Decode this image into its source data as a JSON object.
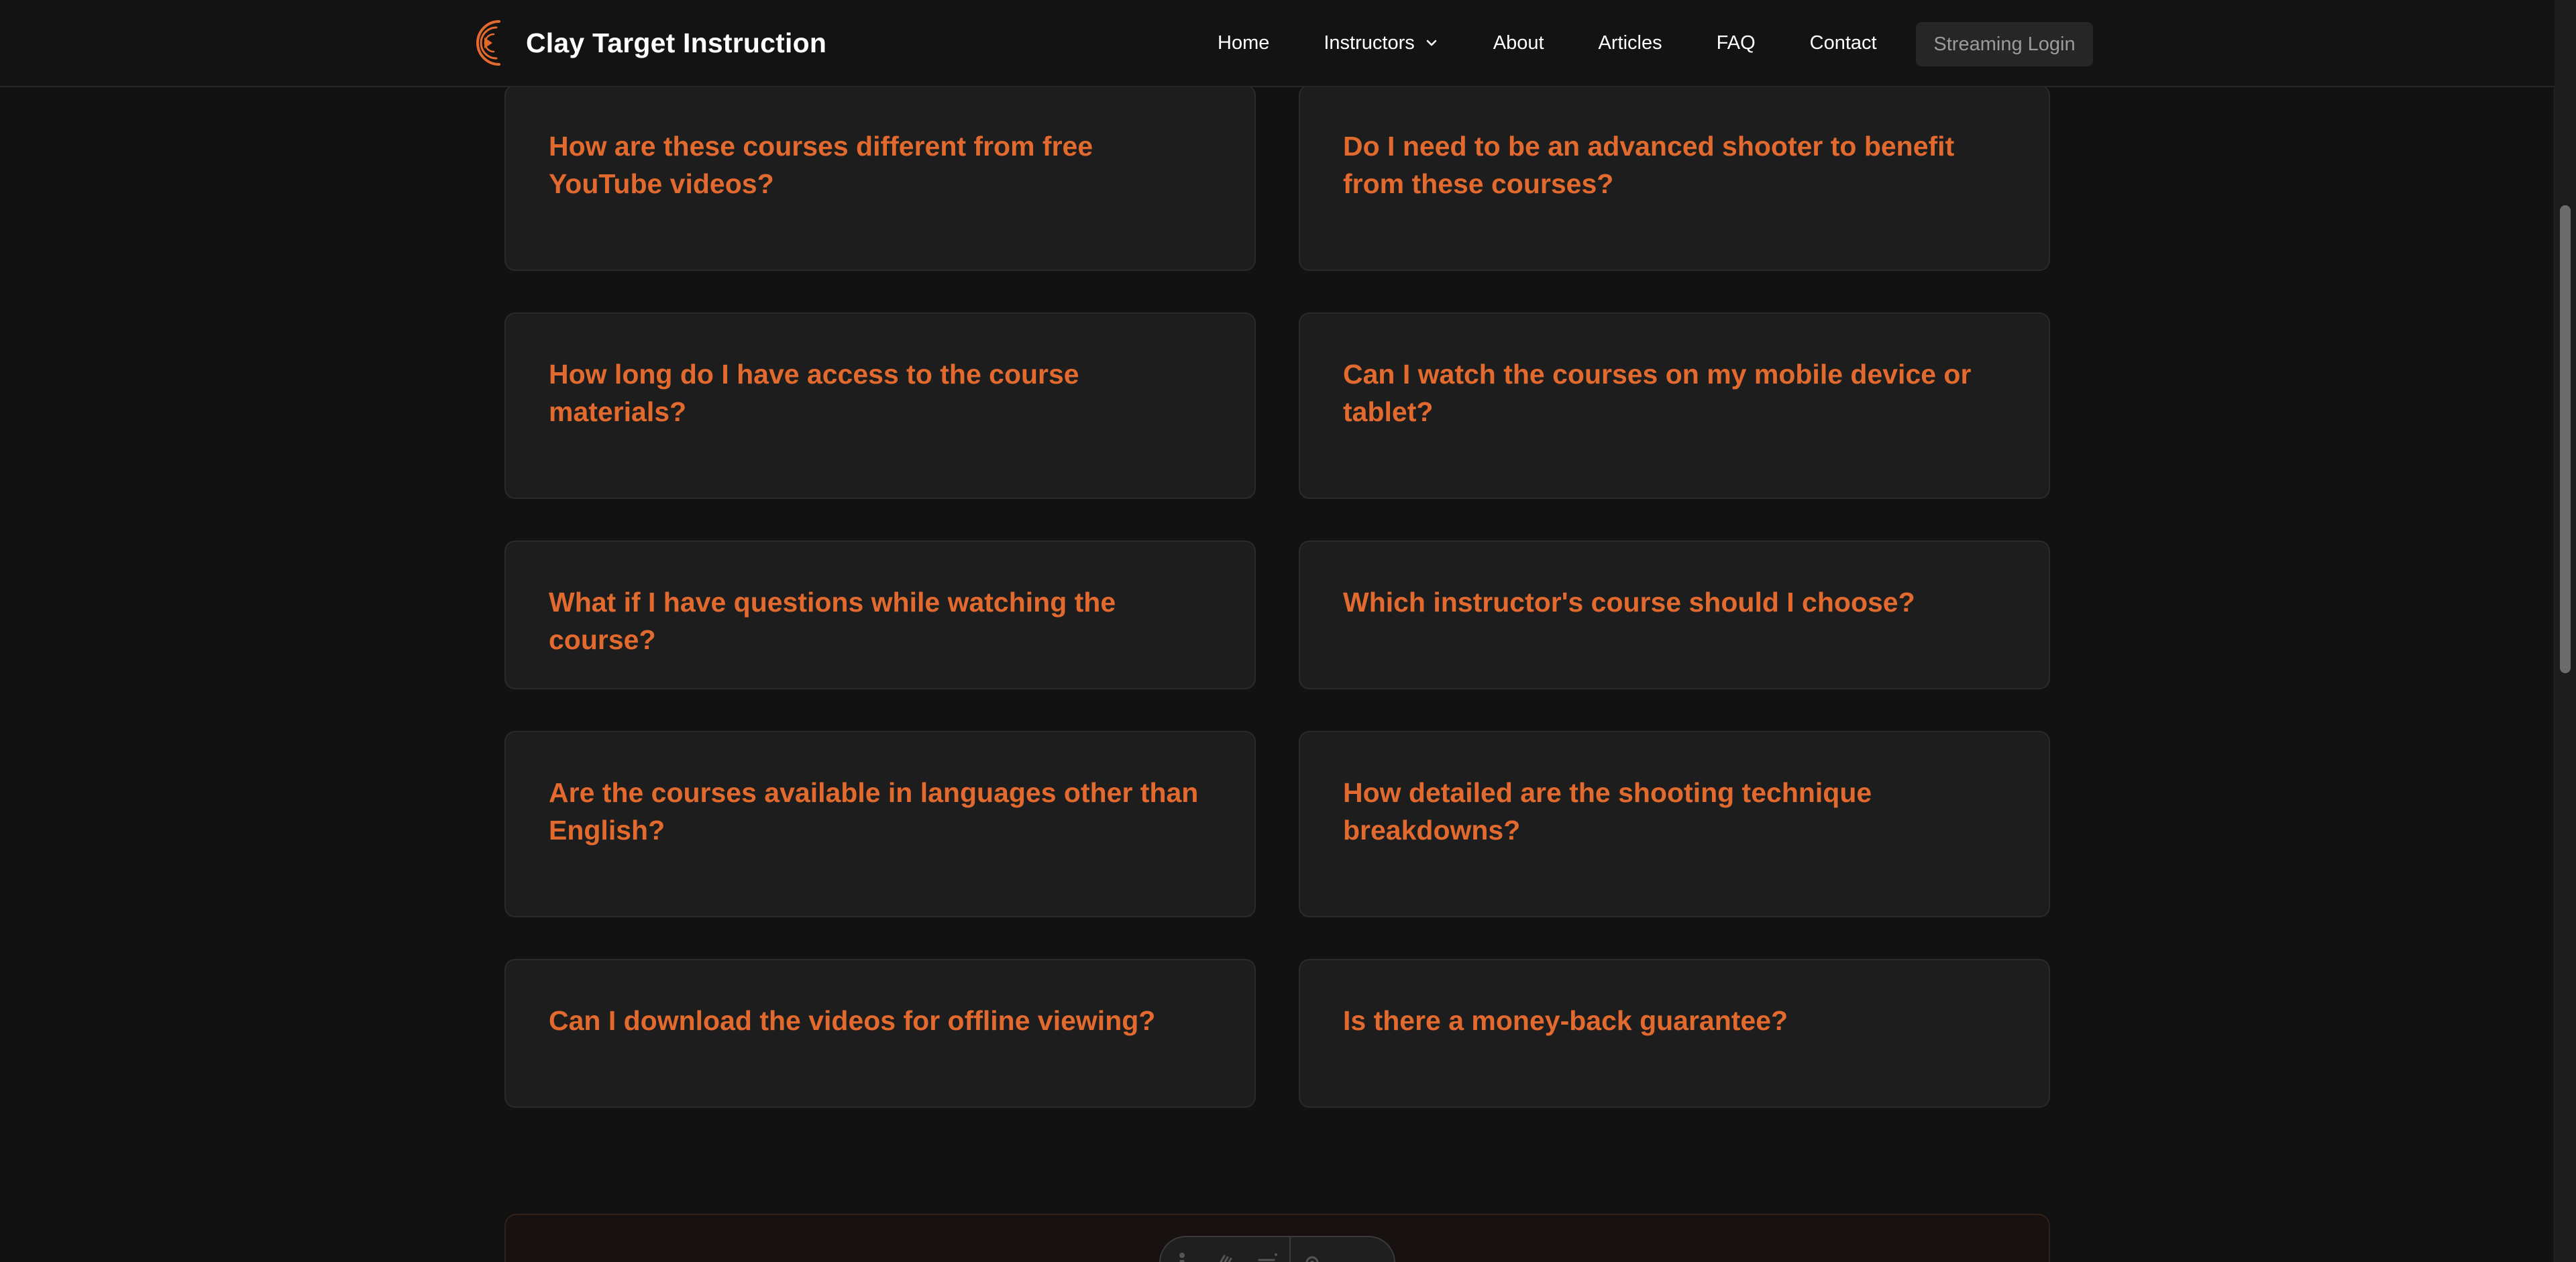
{
  "header": {
    "brand_name": "Clay Target Instruction",
    "nav": [
      {
        "label": "Home"
      },
      {
        "label": "Instructors",
        "has_dropdown": true
      },
      {
        "label": "About"
      },
      {
        "label": "Articles"
      },
      {
        "label": "FAQ"
      },
      {
        "label": "Contact"
      }
    ],
    "login_label": "Streaming Login"
  },
  "faq": {
    "questions": [
      "How are these courses different from free YouTube videos?",
      "Do I need to be an advanced shooter to benefit from these courses?",
      "How long do I have access to the course materials?",
      "Can I watch the courses on my mobile device or tablet?",
      "What if I have questions while watching the course?",
      "Which instructor's course should I choose?",
      "Are the courses available in languages other than English?",
      "How detailed are the shooting technique breakdowns?",
      "Can I download the videos for offline viewing?",
      "Is there a money-back guarantee?"
    ]
  },
  "toolbar": {
    "icons": [
      "accessibility-icon",
      "hand-icon",
      "text-size-icon",
      "settings-icon"
    ]
  },
  "colors": {
    "background": "#121212",
    "card": "#1d1d1d",
    "accent": "#e36a2e",
    "text": "#ffffff",
    "muted": "#9b9b9b"
  }
}
